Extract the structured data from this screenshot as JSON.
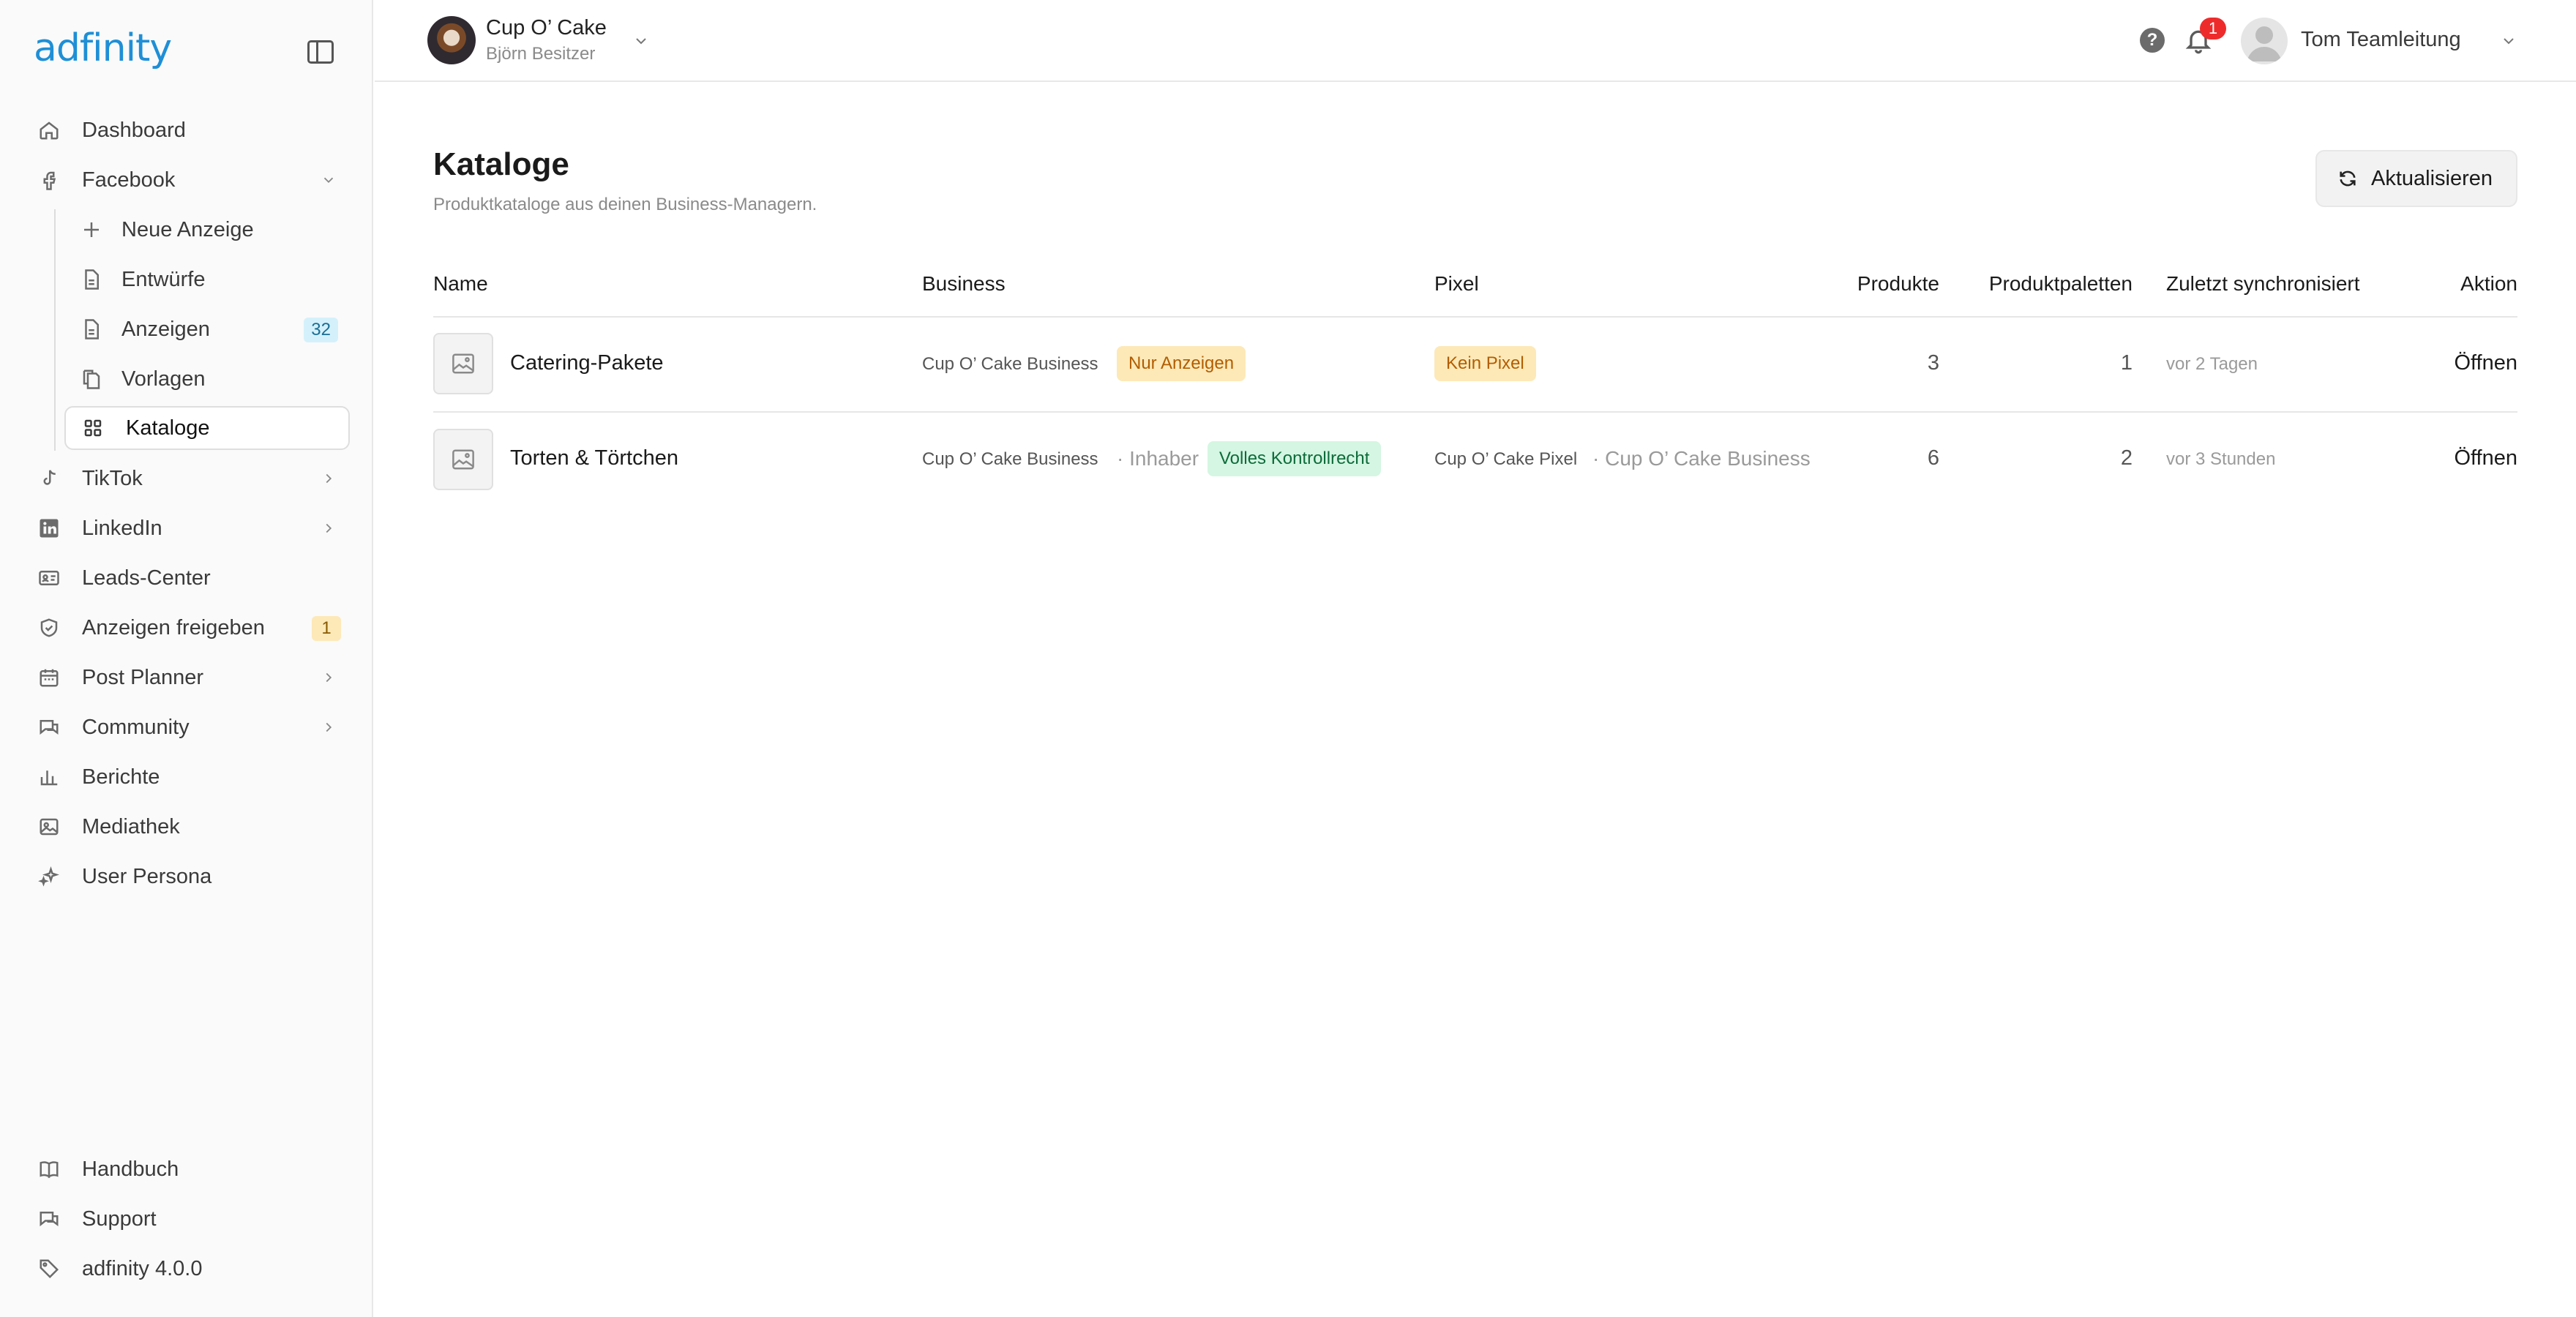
{
  "sidebar": {
    "logo": "adfinity",
    "items": {
      "dashboard": "Dashboard",
      "facebook": "Facebook",
      "neue_anzeige": "Neue Anzeige",
      "entwuerfe": "Entwürfe",
      "anzeigen": "Anzeigen",
      "anzeigen_badge": "32",
      "vorlagen": "Vorlagen",
      "kataloge": "Kataloge",
      "tiktok": "TikTok",
      "linkedin": "LinkedIn",
      "leads_center": "Leads-Center",
      "anzeigen_freigeben": "Anzeigen freigeben",
      "anzeigen_freigeben_badge": "1",
      "post_planner": "Post Planner",
      "community": "Community",
      "berichte": "Berichte",
      "mediathek": "Mediathek",
      "user_persona": "User Persona"
    },
    "footer": {
      "handbuch": "Handbuch",
      "support": "Support",
      "version": "adfinity 4.0.0"
    }
  },
  "topbar": {
    "account_name": "Cup O’ Cake",
    "account_role": "Björn Besitzer",
    "notification_count": "1",
    "help_label": "?",
    "user_name": "Tom Teamleitung"
  },
  "main": {
    "title": "Kataloge",
    "subtitle": "Produktkataloge aus deinen Business-Managern.",
    "refresh_label": "Aktualisieren",
    "columns": {
      "name": "Name",
      "business": "Business",
      "pixel": "Pixel",
      "produkte": "Produkte",
      "produktpaletten": "Produktpaletten",
      "zuletzt": "Zuletzt synchronisiert",
      "aktion": "Aktion"
    },
    "rows": [
      {
        "name": "Catering-Pakete",
        "business": "Cup O’ Cake Business",
        "business_role": "",
        "business_tag": "Nur Anzeigen",
        "pixel_tag": "Kein Pixel",
        "pixel": "",
        "pixel_business": "",
        "produkte": "3",
        "produktpaletten": "1",
        "synced": "vor 2 Tagen",
        "action": "Öffnen"
      },
      {
        "name": "Torten & Törtchen",
        "business": "Cup O’ Cake Business",
        "business_role": "· Inhaber",
        "business_tag": "Volles Kontrollrecht",
        "pixel_tag": "",
        "pixel": "Cup O’ Cake Pixel",
        "pixel_business": "· Cup O’ Cake Business",
        "produkte": "6",
        "produktpaletten": "2",
        "synced": "vor 3 Stunden",
        "action": "Öffnen"
      }
    ]
  },
  "colors": {
    "brand": "#1f8fd6",
    "badge_blue": "#d4f1fb",
    "badge_yellow": "#fde9b8",
    "badge_green": "#d4f6e2",
    "notification": "#ee2b2b"
  }
}
